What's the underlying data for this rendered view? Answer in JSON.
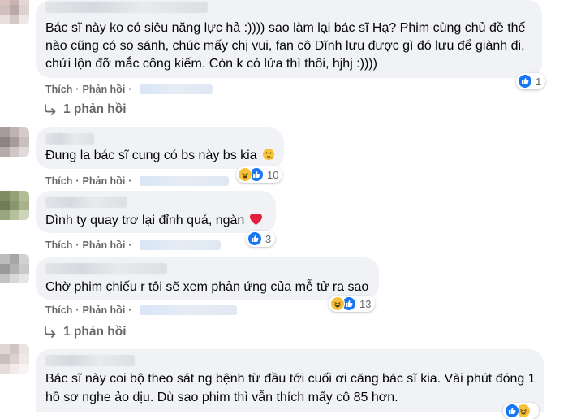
{
  "actions": {
    "like": "Thích",
    "reply": "Phản hồi"
  },
  "comments": [
    {
      "lines": [
        "Bác sĩ này ko có siêu năng lực hả :)))) sao làm lại bác sĩ Hạ? Phim cùng chủ đề thế",
        "nào cũng có so sánh, chúc mấy chị vui, fan cô Dĩnh lưu được gì đó lưu để giành đi,",
        "chửi lộn đỡ mắc công kiếm. Còn k có lửa thì thôi, hjhj :))))"
      ],
      "reactions": {
        "icons": [
          "like-icon"
        ],
        "count": "1"
      },
      "replies": "1 phản hồi"
    },
    {
      "lines": [
        "Đung la bác sĩ cung có bs này bs kia"
      ],
      "emoji": "thinking-face-icon",
      "reactions": {
        "icons": [
          "haha-icon",
          "like-icon"
        ],
        "count": "10"
      }
    },
    {
      "lines": [
        "Dình ty quay trơ lại đỉnh quá, ngàn"
      ],
      "emoji": "red-heart-icon",
      "reactions": {
        "icons": [
          "like-icon"
        ],
        "count": "3"
      }
    },
    {
      "lines": [
        "Chờ phim chiếu r tôi sẽ xem phản ứng của mễ tử ra sao"
      ],
      "reactions": {
        "icons": [
          "haha-icon",
          "like-icon"
        ],
        "count": "13"
      },
      "replies": "1 phản hồi"
    },
    {
      "lines": [
        "Bác sĩ này coi bộ theo sát ng bệnh từ đầu tới cuối ơi căng bác sĩ kia. Vài phút đóng 1",
        "hồ sơ nghe ảo dịu. Dù sao phim thì vẫn thích mấy cô 85 hơn."
      ],
      "reactions": {
        "icons": [
          "like-icon",
          "haha-icon"
        ],
        "count": ""
      }
    }
  ],
  "colors": {
    "bubble": "#f0f2f5",
    "like_blue": "#1877f2",
    "haha_yellow": "#f7c23a",
    "secondary_text": "#65676b",
    "heart_red": "#e41e3f"
  }
}
